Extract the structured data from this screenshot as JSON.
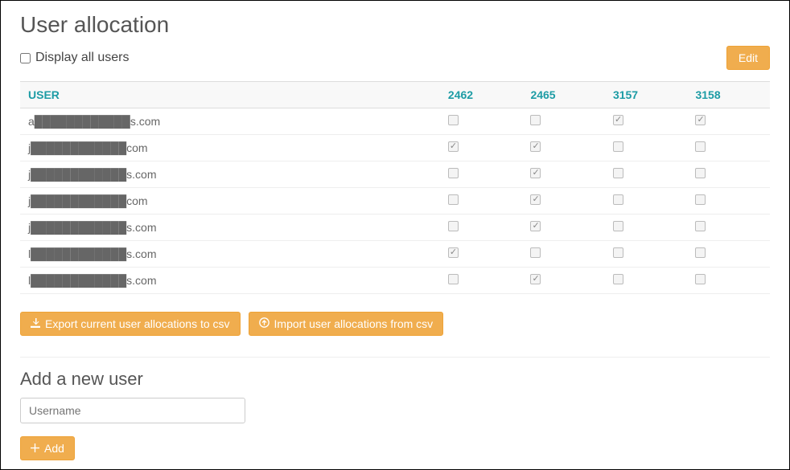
{
  "page_title": "User allocation",
  "display_all_label": "Display all users",
  "display_all_checked": false,
  "edit_button_label": "Edit",
  "columns": {
    "user_header": "USER",
    "ids": [
      "2462",
      "2465",
      "3157",
      "3158"
    ]
  },
  "rows": [
    {
      "user": "a████████████s.com",
      "checks": [
        false,
        false,
        true,
        true
      ]
    },
    {
      "user": "j████████████com",
      "checks": [
        true,
        true,
        false,
        false
      ]
    },
    {
      "user": "j████████████s.com",
      "checks": [
        false,
        true,
        false,
        false
      ]
    },
    {
      "user": "j████████████com",
      "checks": [
        false,
        true,
        false,
        false
      ]
    },
    {
      "user": "j████████████s.com",
      "checks": [
        false,
        true,
        false,
        false
      ]
    },
    {
      "user": "l████████████s.com",
      "checks": [
        true,
        false,
        false,
        false
      ]
    },
    {
      "user": "l████████████s.com",
      "checks": [
        false,
        true,
        false,
        false
      ]
    }
  ],
  "export_button_label": "Export current user allocations to csv",
  "import_button_label": "Import user allocations from csv",
  "add_user_section_title": "Add a new user",
  "username_placeholder": "Username",
  "add_button_label": "Add"
}
